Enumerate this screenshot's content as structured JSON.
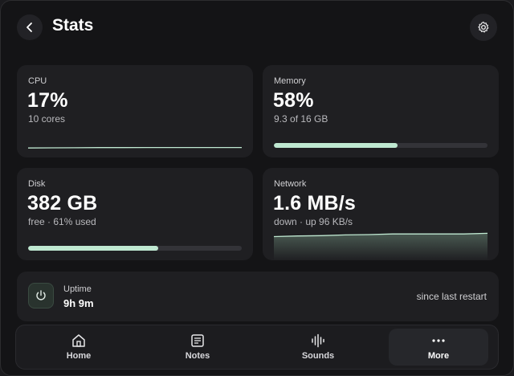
{
  "header": {
    "title": "Stats",
    "back_icon": "chevron-left-icon",
    "settings_icon": "gear-icon"
  },
  "cards": {
    "cpu": {
      "label": "CPU",
      "value": "17%",
      "sub": "10 cores",
      "trend": [
        0.06,
        0.07,
        0.08,
        0.09,
        0.09,
        0.1,
        0.1,
        0.1,
        0.1,
        0.1
      ]
    },
    "memory": {
      "label": "Memory",
      "value": "58%",
      "sub": "9.3 of 16 GB",
      "level": 0.58
    },
    "disk": {
      "label": "Disk",
      "value": "382 GB",
      "sub": "free · 61% used",
      "level": 0.61
    },
    "network": {
      "label": "Network",
      "value": "1.6 MB/s",
      "sub": "down · up 96 KB/s",
      "trend": [
        0.72,
        0.74,
        0.75,
        0.77,
        0.78,
        0.8,
        0.8,
        0.8,
        0.8,
        0.82
      ]
    }
  },
  "uptime": {
    "label": "Uptime",
    "value": "9h 9m",
    "note": "since last restart",
    "icon": "power-icon"
  },
  "nav": {
    "items": [
      {
        "label": "Home",
        "icon": "home-icon"
      },
      {
        "label": "Notes",
        "icon": "notes-icon"
      },
      {
        "label": "Sounds",
        "icon": "waveform-icon"
      },
      {
        "label": "More",
        "icon": "ellipsis-icon",
        "active": true
      }
    ]
  },
  "colors": {
    "accent": "#bfe8d1",
    "card": "#1f1f22",
    "background": "#141416"
  }
}
